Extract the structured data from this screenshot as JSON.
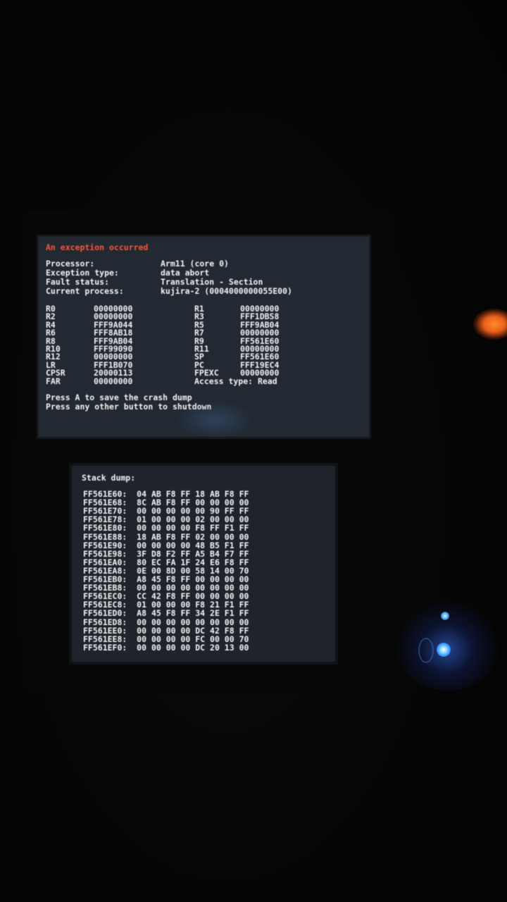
{
  "top_screen": {
    "title": "An exception occurred",
    "info": [
      {
        "label": "Processor:",
        "value": "Arm11 (core 0)"
      },
      {
        "label": "Exception type:",
        "value": "data abort"
      },
      {
        "label": "Fault status:",
        "value": "Translation - Section"
      },
      {
        "label": "Current process:",
        "value": "kujira-2 (0004000000055E00)"
      }
    ],
    "registers": [
      {
        "n1": "R0",
        "v1": "00000000",
        "n2": "R1",
        "v2": "00000000"
      },
      {
        "n1": "R2",
        "v1": "00000000",
        "n2": "R3",
        "v2": "FFF1DBS8"
      },
      {
        "n1": "R4",
        "v1": "FFF9A044",
        "n2": "R5",
        "v2": "FFF9AB04"
      },
      {
        "n1": "R6",
        "v1": "FFF8AB18",
        "n2": "R7",
        "v2": "00000000"
      },
      {
        "n1": "R8",
        "v1": "FFF9AB04",
        "n2": "R9",
        "v2": "FF561E60"
      },
      {
        "n1": "R10",
        "v1": "FFF99090",
        "n2": "R11",
        "v2": "00000000"
      },
      {
        "n1": "R12",
        "v1": "00000000",
        "n2": "SP",
        "v2": "FF561E60"
      },
      {
        "n1": "LR",
        "v1": "FFF1B070",
        "n2": "PC",
        "v2": "FFF19EC4"
      },
      {
        "n1": "CPSR",
        "v1": "20000113",
        "n2": "FPEXC",
        "v2": "00000000"
      },
      {
        "n1": "FAR",
        "v1": "00000000",
        "n2": "Access type: Read",
        "v2": ""
      }
    ],
    "prompt_lines": [
      "Press A to save the crash dump",
      "Press any other button to shutdown"
    ]
  },
  "bottom_screen": {
    "title": "Stack dump:",
    "rows": [
      {
        "addr": "FF561E60:",
        "bytes": "04 AB F8 FF 18 AB F8 FF"
      },
      {
        "addr": "FF561E68:",
        "bytes": "8C AB F8 FF 00 00 00 00"
      },
      {
        "addr": "FF561E70:",
        "bytes": "00 00 00 00 00 90 FF FF"
      },
      {
        "addr": "FF561E78:",
        "bytes": "01 00 00 00 02 00 00 00"
      },
      {
        "addr": "FF561E80:",
        "bytes": "00 00 00 00 F8 FF F1 FF"
      },
      {
        "addr": "FF561E88:",
        "bytes": "18 AB F8 FF 02 00 00 00"
      },
      {
        "addr": "FF561E90:",
        "bytes": "00 00 00 00 48 B5 F1 FF"
      },
      {
        "addr": "FF561E98:",
        "bytes": "3F D8 F2 FF A5 B4 F7 FF"
      },
      {
        "addr": "FF561EA0:",
        "bytes": "80 EC FA 1F 24 E6 F8 FF"
      },
      {
        "addr": "FF561EA8:",
        "bytes": "0E 00 8D 00 58 14 00 70"
      },
      {
        "addr": "FF561EB0:",
        "bytes": "A8 45 F8 FF 00 00 00 00"
      },
      {
        "addr": "FF561EB8:",
        "bytes": "00 00 00 00 00 00 00 00"
      },
      {
        "addr": "FF561EC0:",
        "bytes": "CC 42 F8 FF 00 00 00 00"
      },
      {
        "addr": "FF561EC8:",
        "bytes": "01 00 00 00 F8 21 F1 FF"
      },
      {
        "addr": "FF561ED0:",
        "bytes": "A8 45 F8 FF 34 2E F1 FF"
      },
      {
        "addr": "FF561ED8:",
        "bytes": "00 00 00 00 00 00 00 00"
      },
      {
        "addr": "FF561EE0:",
        "bytes": "00 00 00 00 DC 42 F8 FF"
      },
      {
        "addr": "FF561EE8:",
        "bytes": "00 00 00 00 FC 00 00 70"
      },
      {
        "addr": "FF561EF0:",
        "bytes": "00 00 00 00 DC 20 13 00"
      }
    ]
  },
  "colors": {
    "error_title": "#ff5236",
    "screen_text": "#f2f2f2",
    "power_led": "#2a7bff",
    "charge_led": "#ff8a2a"
  }
}
